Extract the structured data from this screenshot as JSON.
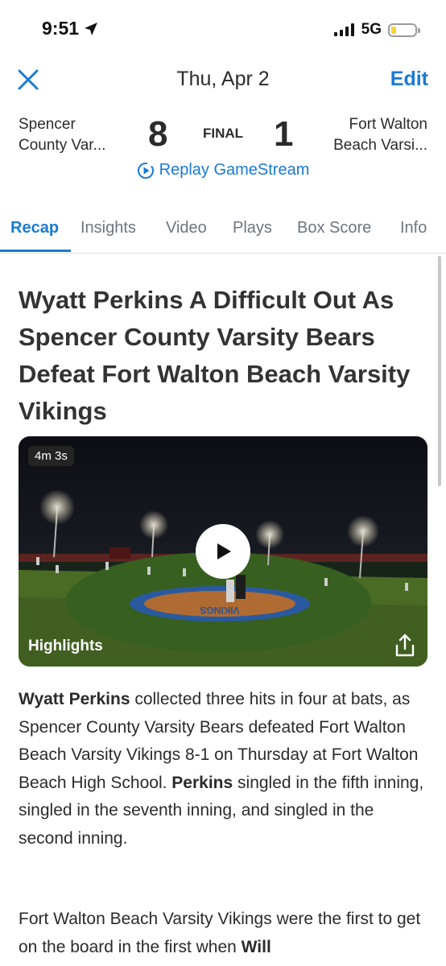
{
  "status_bar": {
    "time": "9:51",
    "network": "5G"
  },
  "nav": {
    "date": "Thu, Apr 2",
    "edit_label": "Edit"
  },
  "game": {
    "home_team_line1": "Spencer",
    "home_team_line2": "County Var...",
    "home_score": "8",
    "status": "FINAL",
    "away_score": "1",
    "away_team_line1": "Fort Walton",
    "away_team_line2": "Beach Varsi...",
    "replay_label": "Replay GameStream"
  },
  "tabs": [
    "Recap",
    "Insights",
    "Video",
    "Plays",
    "Box Score",
    "Info"
  ],
  "recap": {
    "headline": "Wyatt Perkins A Difficult Out As Spencer County Varsity Bears Defeat Fort Walton Beach Varsity Vikings",
    "video": {
      "duration": "4m 3s",
      "label": "Highlights",
      "field_text": "VIKINGS"
    },
    "p1_name": "Wyatt Perkins",
    "p1_text1": " collected three hits in four at bats, as Spencer County Varsity Bears defeated Fort Walton Beach Varsity Vikings 8-1 on Thursday at Fort Walton Beach High School. ",
    "p1_name2": "Perkins",
    "p1_text2": " singled in the fifth inning, singled in the seventh inning, and singled in the second inning.",
    "p2_text": "Fort Walton Beach Varsity Vikings were the first to get on the board in the first when ",
    "p2_name": "Will"
  },
  "colors": {
    "accent": "#1a7ad6",
    "text": "#2b2b2b",
    "tab_inactive": "#6e7480"
  }
}
